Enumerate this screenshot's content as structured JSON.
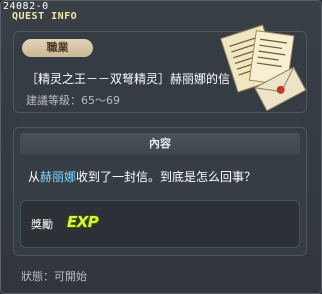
{
  "window": {
    "quest_id": "24082-0",
    "title": "QUEST INFO"
  },
  "quest": {
    "job_label": "職業",
    "name": "［精灵之王－－双弩精灵］赫丽娜的信",
    "level_text": "建議等級：65～69",
    "icon": "letters-scroll-icon"
  },
  "content": {
    "header": "內容",
    "text_before": "从",
    "npc_name": "赫丽娜",
    "text_after": "收到了一封信。到底是怎么回事？"
  },
  "reward": {
    "label": "獎勵",
    "exp_text": "EXP"
  },
  "status": "狀態：可開始",
  "colors": {
    "npc_highlight": "#7fd8ff",
    "exp": "#d8f53a",
    "title": "#f2e6a8"
  }
}
